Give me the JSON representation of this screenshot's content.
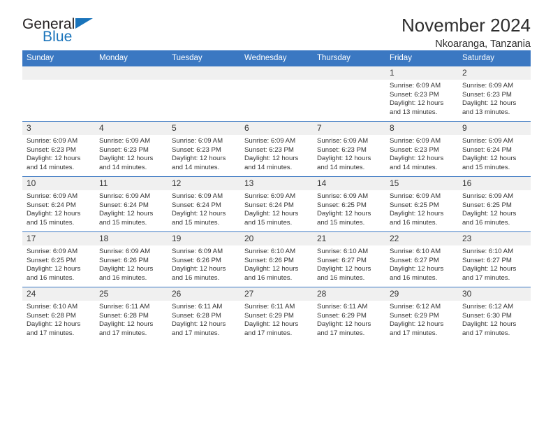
{
  "brand": {
    "name_part1": "General",
    "name_part2": "Blue",
    "flag_icon": "triangle-flag-icon"
  },
  "header": {
    "title": "November 2024",
    "subtitle": "Nkoaranga, Tanzania"
  },
  "colors": {
    "header_blue": "#3b78c2",
    "brand_blue": "#1a74bb",
    "daynum_bg": "#f0f0f0",
    "text": "#333333"
  },
  "weekday_headers": [
    "Sunday",
    "Monday",
    "Tuesday",
    "Wednesday",
    "Thursday",
    "Friday",
    "Saturday"
  ],
  "labels": {
    "sunrise": "Sunrise:",
    "sunset": "Sunset:",
    "daylight": "Daylight:"
  },
  "weeks": [
    [
      {
        "empty": true
      },
      {
        "empty": true
      },
      {
        "empty": true
      },
      {
        "empty": true
      },
      {
        "empty": true
      },
      {
        "day": "1",
        "sunrise": "Sunrise: 6:09 AM",
        "sunset": "Sunset: 6:23 PM",
        "daylight1": "Daylight: 12 hours",
        "daylight2": "and 13 minutes."
      },
      {
        "day": "2",
        "sunrise": "Sunrise: 6:09 AM",
        "sunset": "Sunset: 6:23 PM",
        "daylight1": "Daylight: 12 hours",
        "daylight2": "and 13 minutes."
      }
    ],
    [
      {
        "day": "3",
        "sunrise": "Sunrise: 6:09 AM",
        "sunset": "Sunset: 6:23 PM",
        "daylight1": "Daylight: 12 hours",
        "daylight2": "and 14 minutes."
      },
      {
        "day": "4",
        "sunrise": "Sunrise: 6:09 AM",
        "sunset": "Sunset: 6:23 PM",
        "daylight1": "Daylight: 12 hours",
        "daylight2": "and 14 minutes."
      },
      {
        "day": "5",
        "sunrise": "Sunrise: 6:09 AM",
        "sunset": "Sunset: 6:23 PM",
        "daylight1": "Daylight: 12 hours",
        "daylight2": "and 14 minutes."
      },
      {
        "day": "6",
        "sunrise": "Sunrise: 6:09 AM",
        "sunset": "Sunset: 6:23 PM",
        "daylight1": "Daylight: 12 hours",
        "daylight2": "and 14 minutes."
      },
      {
        "day": "7",
        "sunrise": "Sunrise: 6:09 AM",
        "sunset": "Sunset: 6:23 PM",
        "daylight1": "Daylight: 12 hours",
        "daylight2": "and 14 minutes."
      },
      {
        "day": "8",
        "sunrise": "Sunrise: 6:09 AM",
        "sunset": "Sunset: 6:23 PM",
        "daylight1": "Daylight: 12 hours",
        "daylight2": "and 14 minutes."
      },
      {
        "day": "9",
        "sunrise": "Sunrise: 6:09 AM",
        "sunset": "Sunset: 6:24 PM",
        "daylight1": "Daylight: 12 hours",
        "daylight2": "and 15 minutes."
      }
    ],
    [
      {
        "day": "10",
        "sunrise": "Sunrise: 6:09 AM",
        "sunset": "Sunset: 6:24 PM",
        "daylight1": "Daylight: 12 hours",
        "daylight2": "and 15 minutes."
      },
      {
        "day": "11",
        "sunrise": "Sunrise: 6:09 AM",
        "sunset": "Sunset: 6:24 PM",
        "daylight1": "Daylight: 12 hours",
        "daylight2": "and 15 minutes."
      },
      {
        "day": "12",
        "sunrise": "Sunrise: 6:09 AM",
        "sunset": "Sunset: 6:24 PM",
        "daylight1": "Daylight: 12 hours",
        "daylight2": "and 15 minutes."
      },
      {
        "day": "13",
        "sunrise": "Sunrise: 6:09 AM",
        "sunset": "Sunset: 6:24 PM",
        "daylight1": "Daylight: 12 hours",
        "daylight2": "and 15 minutes."
      },
      {
        "day": "14",
        "sunrise": "Sunrise: 6:09 AM",
        "sunset": "Sunset: 6:25 PM",
        "daylight1": "Daylight: 12 hours",
        "daylight2": "and 15 minutes."
      },
      {
        "day": "15",
        "sunrise": "Sunrise: 6:09 AM",
        "sunset": "Sunset: 6:25 PM",
        "daylight1": "Daylight: 12 hours",
        "daylight2": "and 16 minutes."
      },
      {
        "day": "16",
        "sunrise": "Sunrise: 6:09 AM",
        "sunset": "Sunset: 6:25 PM",
        "daylight1": "Daylight: 12 hours",
        "daylight2": "and 16 minutes."
      }
    ],
    [
      {
        "day": "17",
        "sunrise": "Sunrise: 6:09 AM",
        "sunset": "Sunset: 6:25 PM",
        "daylight1": "Daylight: 12 hours",
        "daylight2": "and 16 minutes."
      },
      {
        "day": "18",
        "sunrise": "Sunrise: 6:09 AM",
        "sunset": "Sunset: 6:26 PM",
        "daylight1": "Daylight: 12 hours",
        "daylight2": "and 16 minutes."
      },
      {
        "day": "19",
        "sunrise": "Sunrise: 6:09 AM",
        "sunset": "Sunset: 6:26 PM",
        "daylight1": "Daylight: 12 hours",
        "daylight2": "and 16 minutes."
      },
      {
        "day": "20",
        "sunrise": "Sunrise: 6:10 AM",
        "sunset": "Sunset: 6:26 PM",
        "daylight1": "Daylight: 12 hours",
        "daylight2": "and 16 minutes."
      },
      {
        "day": "21",
        "sunrise": "Sunrise: 6:10 AM",
        "sunset": "Sunset: 6:27 PM",
        "daylight1": "Daylight: 12 hours",
        "daylight2": "and 16 minutes."
      },
      {
        "day": "22",
        "sunrise": "Sunrise: 6:10 AM",
        "sunset": "Sunset: 6:27 PM",
        "daylight1": "Daylight: 12 hours",
        "daylight2": "and 16 minutes."
      },
      {
        "day": "23",
        "sunrise": "Sunrise: 6:10 AM",
        "sunset": "Sunset: 6:27 PM",
        "daylight1": "Daylight: 12 hours",
        "daylight2": "and 17 minutes."
      }
    ],
    [
      {
        "day": "24",
        "sunrise": "Sunrise: 6:10 AM",
        "sunset": "Sunset: 6:28 PM",
        "daylight1": "Daylight: 12 hours",
        "daylight2": "and 17 minutes."
      },
      {
        "day": "25",
        "sunrise": "Sunrise: 6:11 AM",
        "sunset": "Sunset: 6:28 PM",
        "daylight1": "Daylight: 12 hours",
        "daylight2": "and 17 minutes."
      },
      {
        "day": "26",
        "sunrise": "Sunrise: 6:11 AM",
        "sunset": "Sunset: 6:28 PM",
        "daylight1": "Daylight: 12 hours",
        "daylight2": "and 17 minutes."
      },
      {
        "day": "27",
        "sunrise": "Sunrise: 6:11 AM",
        "sunset": "Sunset: 6:29 PM",
        "daylight1": "Daylight: 12 hours",
        "daylight2": "and 17 minutes."
      },
      {
        "day": "28",
        "sunrise": "Sunrise: 6:11 AM",
        "sunset": "Sunset: 6:29 PM",
        "daylight1": "Daylight: 12 hours",
        "daylight2": "and 17 minutes."
      },
      {
        "day": "29",
        "sunrise": "Sunrise: 6:12 AM",
        "sunset": "Sunset: 6:29 PM",
        "daylight1": "Daylight: 12 hours",
        "daylight2": "and 17 minutes."
      },
      {
        "day": "30",
        "sunrise": "Sunrise: 6:12 AM",
        "sunset": "Sunset: 6:30 PM",
        "daylight1": "Daylight: 12 hours",
        "daylight2": "and 17 minutes."
      }
    ]
  ]
}
